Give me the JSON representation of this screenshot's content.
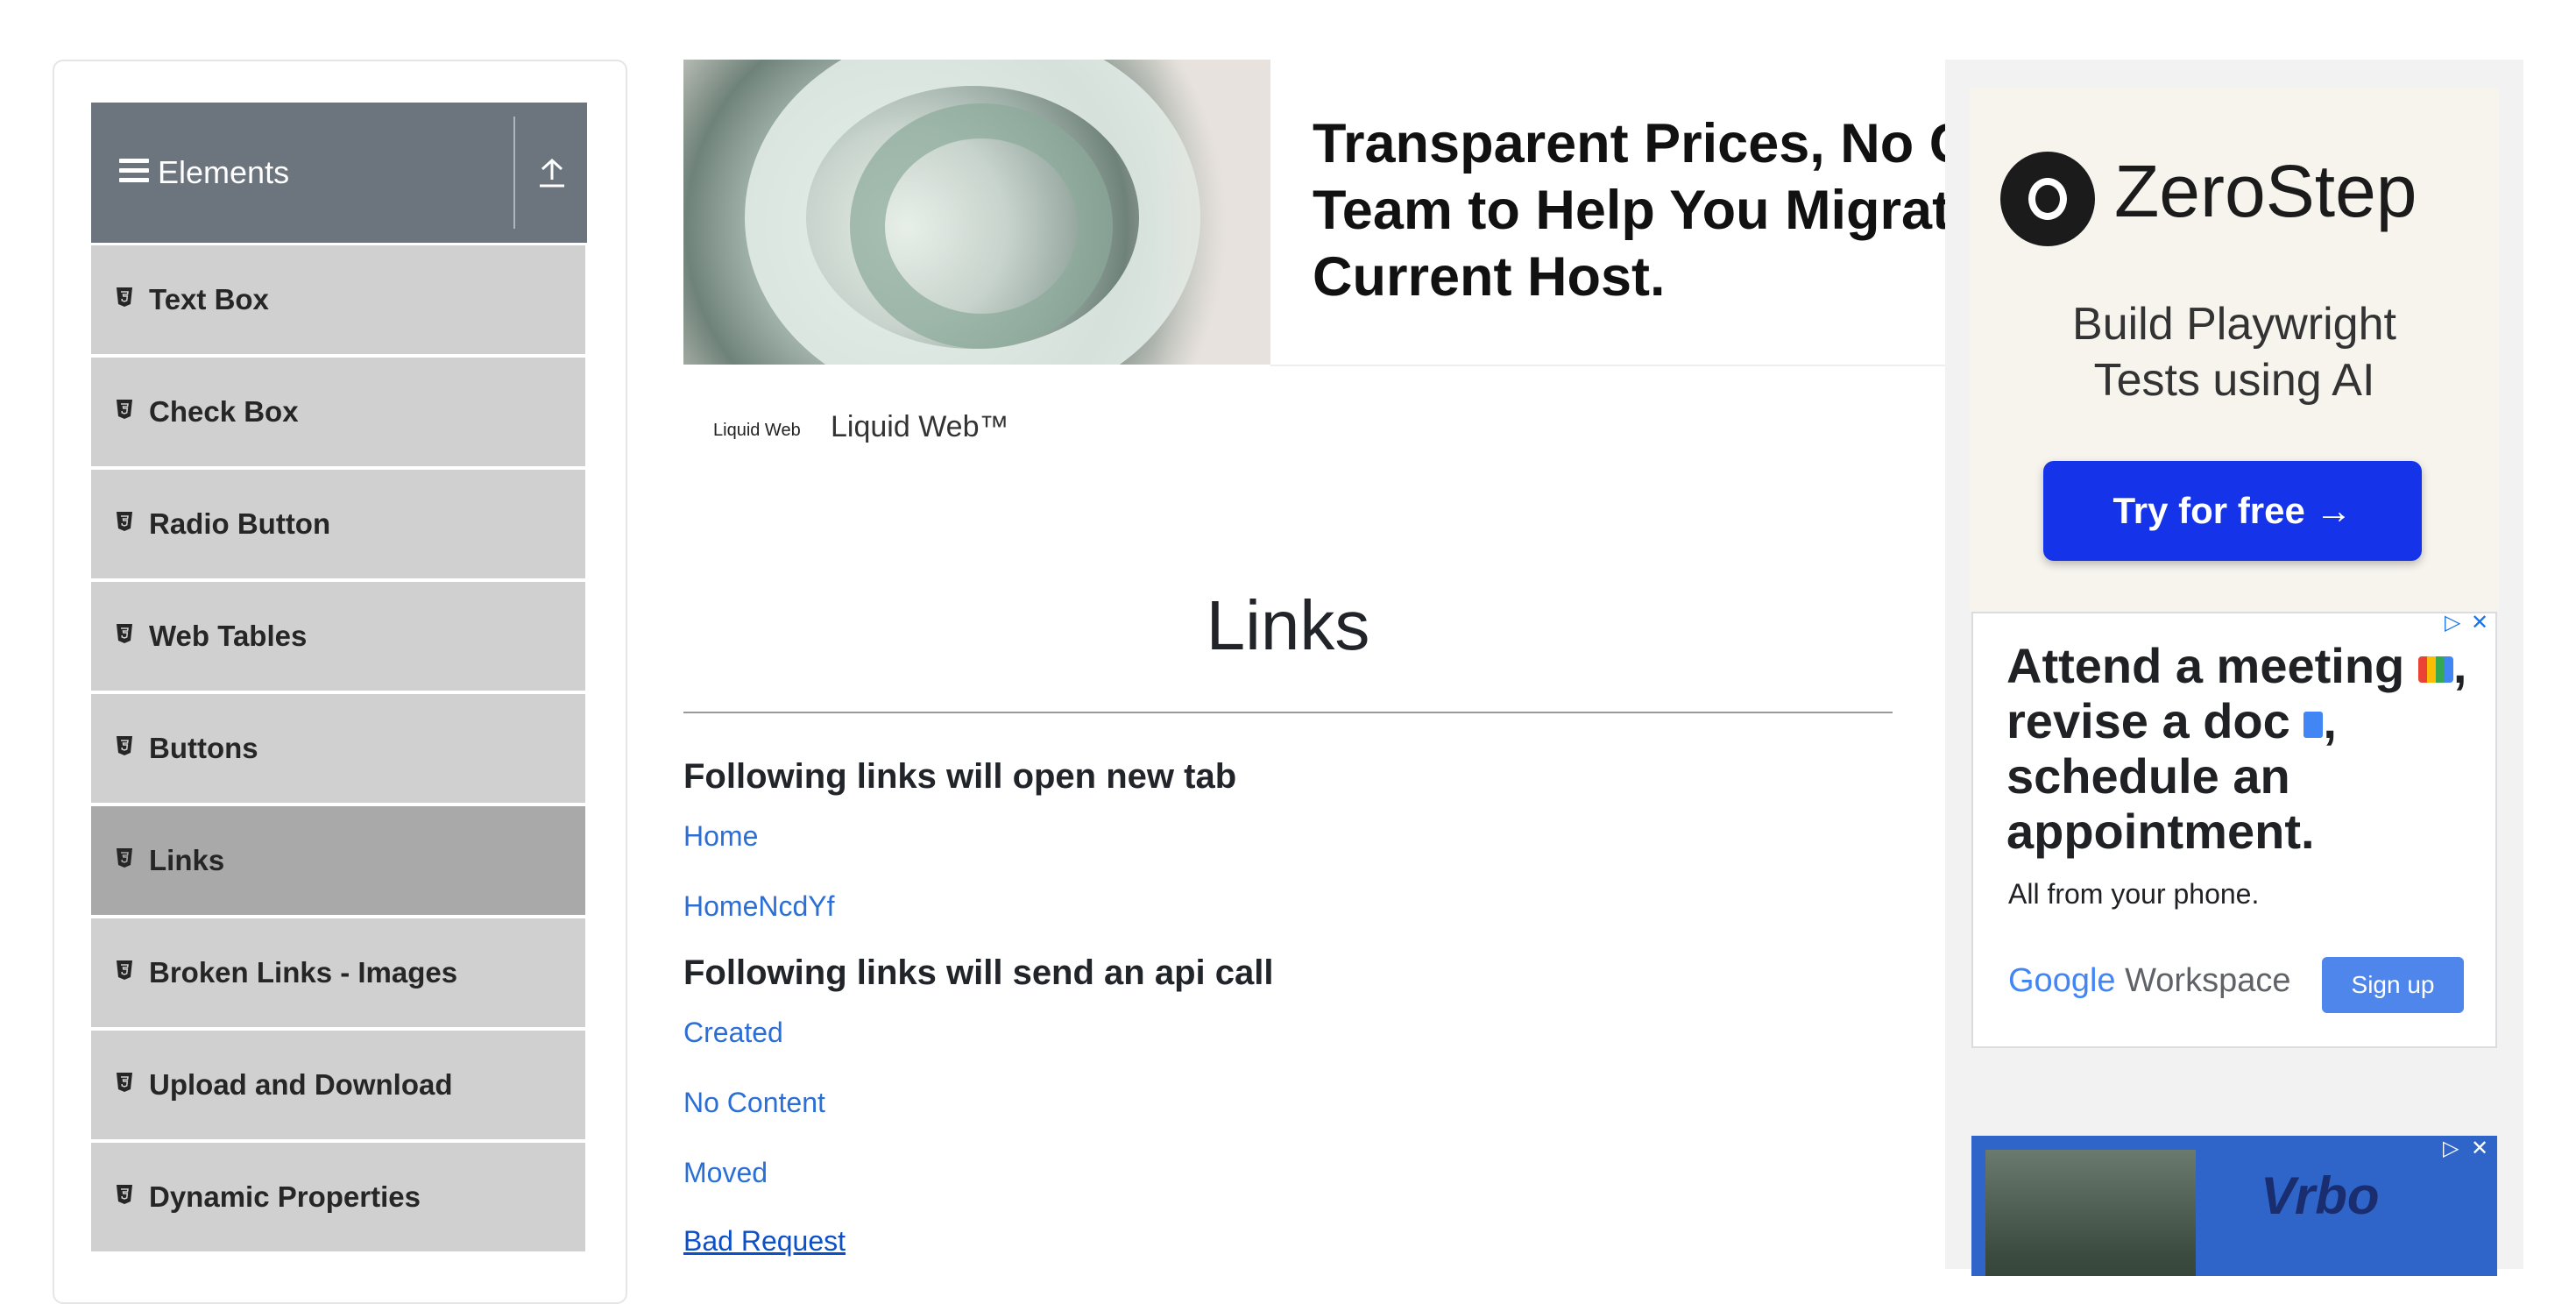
{
  "sidebar": {
    "group_title": "Elements",
    "items": [
      {
        "label": "Text Box"
      },
      {
        "label": "Check Box"
      },
      {
        "label": "Radio Button"
      },
      {
        "label": "Web Tables"
      },
      {
        "label": "Buttons"
      },
      {
        "label": "Links",
        "active": true
      },
      {
        "label": "Broken Links - Images"
      },
      {
        "label": "Upload and Download"
      },
      {
        "label": "Dynamic Properties"
      }
    ]
  },
  "ad_banner": {
    "headline": "Transparent Prices, No Co Team to Help You Migrate Current Host.",
    "headline_lines": [
      "Transparent Prices, No Co",
      "Team to Help You Migrate",
      "Current Host."
    ],
    "brand_small": "Liquid Web",
    "brand": "Liquid Web™"
  },
  "main": {
    "title": "Links",
    "section1_heading": "Following links will open new tab",
    "new_tab_links": [
      "Home",
      "HomeNcdYf"
    ],
    "section2_heading": "Following links will send an api call",
    "api_links": [
      "Created",
      "No Content",
      "Moved",
      "Bad Request"
    ]
  },
  "right_ads": {
    "zerostep": {
      "name": "ZeroStep",
      "subtitle_lines": [
        "Build Playwright",
        "Tests using AI"
      ],
      "cta": "Try for free →"
    },
    "workspace": {
      "headline_lines": [
        "Attend a meeting",
        "revise a doc",
        "schedule an",
        "appointment."
      ],
      "subline": "All from your phone.",
      "brand_google": "Google",
      "brand_workspace": "Workspace",
      "signup": "Sign up",
      "adchoices": "▷",
      "close": "✕"
    },
    "vrbo": {
      "logo": "Vrbo",
      "adchoices": "▷",
      "close": "✕"
    }
  },
  "colors": {
    "group_header": "#6c757d",
    "menu_item": "#d0d0d0",
    "menu_item_active": "#a9a9a9",
    "link": "#2b6fd6",
    "zerostep_cta": "#1533e8",
    "signup": "#4f86ec"
  }
}
